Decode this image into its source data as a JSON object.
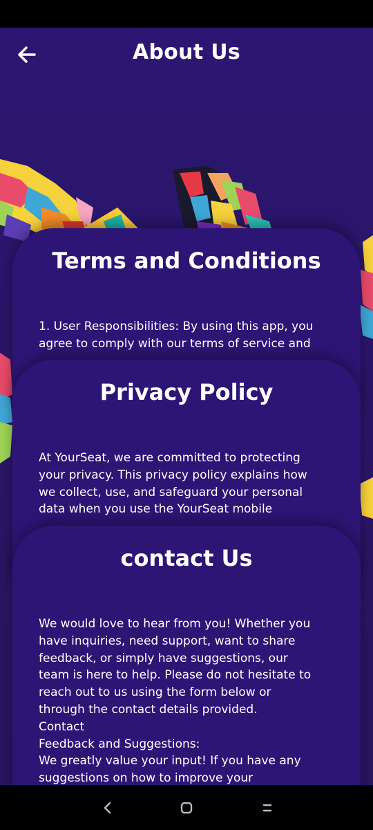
{
  "header": {
    "title": "About Us"
  },
  "icons": {
    "back": "arrow-left",
    "nav_back": "chevron-left",
    "nav_home": "rounded-square",
    "nav_recents": "double-bar"
  },
  "colors": {
    "background": "#2b1670",
    "card": "#2d1575",
    "text": "#ffffff",
    "system_bars": "#000000"
  },
  "sections": [
    {
      "title": "Terms and Conditions",
      "body": "1. User Responsibilities: By using this app, you\nagree to comply with our terms of service and"
    },
    {
      "title": "Privacy Policy",
      "body": "At YourSeat, we are committed to protecting\nyour privacy. This privacy policy explains how\nwe collect, use, and safeguard your personal\ndata when you use the YourSeat mobile"
    },
    {
      "title": "contact Us",
      "body": "We would love to hear from you! Whether you\nhave inquiries, need support, want to share\nfeedback, or simply have suggestions, our\nteam is here to help. Please do not hesitate to\nreach out to us using the form below or\nthrough the contact details provided.\nContact\nFeedback and Suggestions:\nWe greatly value your input! If you have any\nsuggestions on how to improve your"
    }
  ]
}
